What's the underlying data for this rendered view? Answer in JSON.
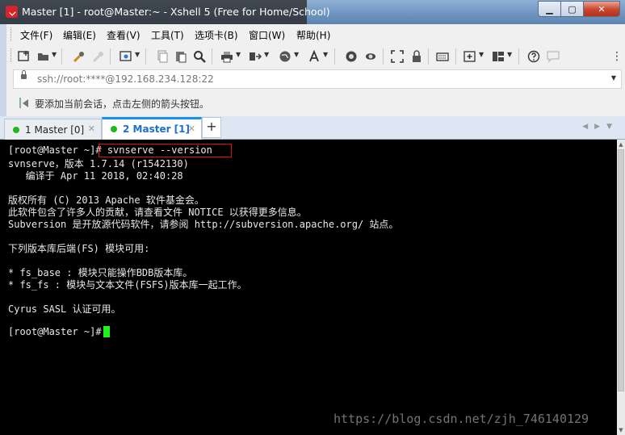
{
  "window": {
    "title": "Master [1] - root@Master:~ - Xshell 5 (Free for Home/School)",
    "buttons": {
      "minimize": "▁",
      "maximize": "▢",
      "close": "✕"
    }
  },
  "menu": {
    "items": [
      {
        "label": "文件(F)"
      },
      {
        "label": "编辑(E)"
      },
      {
        "label": "查看(V)"
      },
      {
        "label": "工具(T)"
      },
      {
        "label": "选项卡(B)"
      },
      {
        "label": "窗口(W)"
      },
      {
        "label": "帮助(H)"
      }
    ]
  },
  "toolbar": {
    "icons": [
      "new-session-icon",
      "open-folder-icon",
      "key-icon",
      "disconnect-icon",
      "properties-icon",
      "copy-icon",
      "paste-icon",
      "find-icon",
      "print-icon",
      "transfer-icon",
      "globe-icon",
      "font-icon",
      "xftp-icon",
      "xshell-icon",
      "fullscreen-icon",
      "lock-icon",
      "keyboard-icon",
      "add-tab-icon",
      "layout-icon",
      "help-icon",
      "chat-icon"
    ]
  },
  "address": {
    "value": "ssh://root:****@192.168.234.128:22"
  },
  "hint": {
    "text": "要添加当前会话，点击左侧的箭头按钮。"
  },
  "tabs": [
    {
      "label": "1 Master [0]",
      "status_color": "#1fb81f",
      "close": "✕"
    },
    {
      "label": "2 Master [1]",
      "status_color": "#1fb81f",
      "close": "✕"
    }
  ],
  "tab_add_label": "+",
  "terminal": {
    "lines": [
      "[root@Master ~]# svnserve --version",
      "svnserve，版本 1.7.14 (r1542130)",
      "   编译于 Apr 11 2018, 02:40:28",
      "",
      "版权所有 (C) 2013 Apache 软件基金会。",
      "此软件包含了许多人的贡献，请查看文件 NOTICE 以获得更多信息。",
      "Subversion 是开放源代码软件，请参阅 http://subversion.apache.org/ 站点。",
      "",
      "下列版本库后端(FS) 模块可用:",
      "",
      "* fs_base : 模块只能操作BDB版本库。",
      "* fs_fs : 模块与文本文件(FSFS)版本库一起工作。",
      "",
      "Cyrus SASL 认证可用。",
      "",
      "[root@Master ~]# "
    ],
    "cursor_color": "#1cf21c",
    "highlight_color": "#dd1111"
  },
  "watermark": "https://blog.csdn.net/zjh_746140129"
}
